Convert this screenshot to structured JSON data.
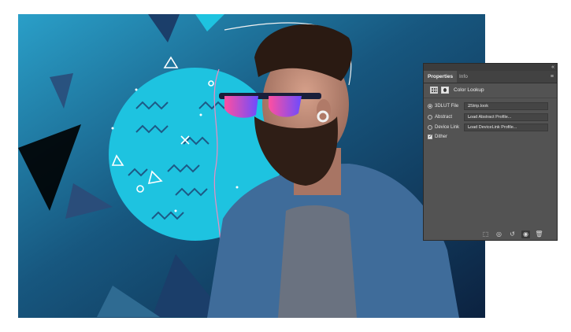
{
  "panel": {
    "collapse_glyph": "«",
    "close_glyph": "×",
    "tabs": [
      {
        "label": "Properties",
        "active": true
      },
      {
        "label": "Info",
        "active": false
      }
    ],
    "menu_glyph": "≡",
    "header_title": "Color Lookup",
    "rows": [
      {
        "label": "3DLUT File",
        "value": "2Strip.look",
        "selected": true
      },
      {
        "label": "Abstract",
        "value": "Load Abstract Profile...",
        "selected": false
      },
      {
        "label": "Device Link",
        "value": "Load DeviceLink Profile...",
        "selected": false
      }
    ],
    "dither_label": "Dither",
    "dither_checked": true,
    "footer_icons": [
      "clip-to-layer-icon",
      "view-previous-state-icon",
      "reset-icon",
      "visibility-eye-icon",
      "trash-icon"
    ],
    "footer_glyphs": [
      "⬚",
      "◎",
      "↺",
      "◉",
      "🗑"
    ]
  },
  "colors": {
    "canvas_bg": "#0d2a4a",
    "circle": "#1ec3e0",
    "panel_bg": "#535353"
  }
}
